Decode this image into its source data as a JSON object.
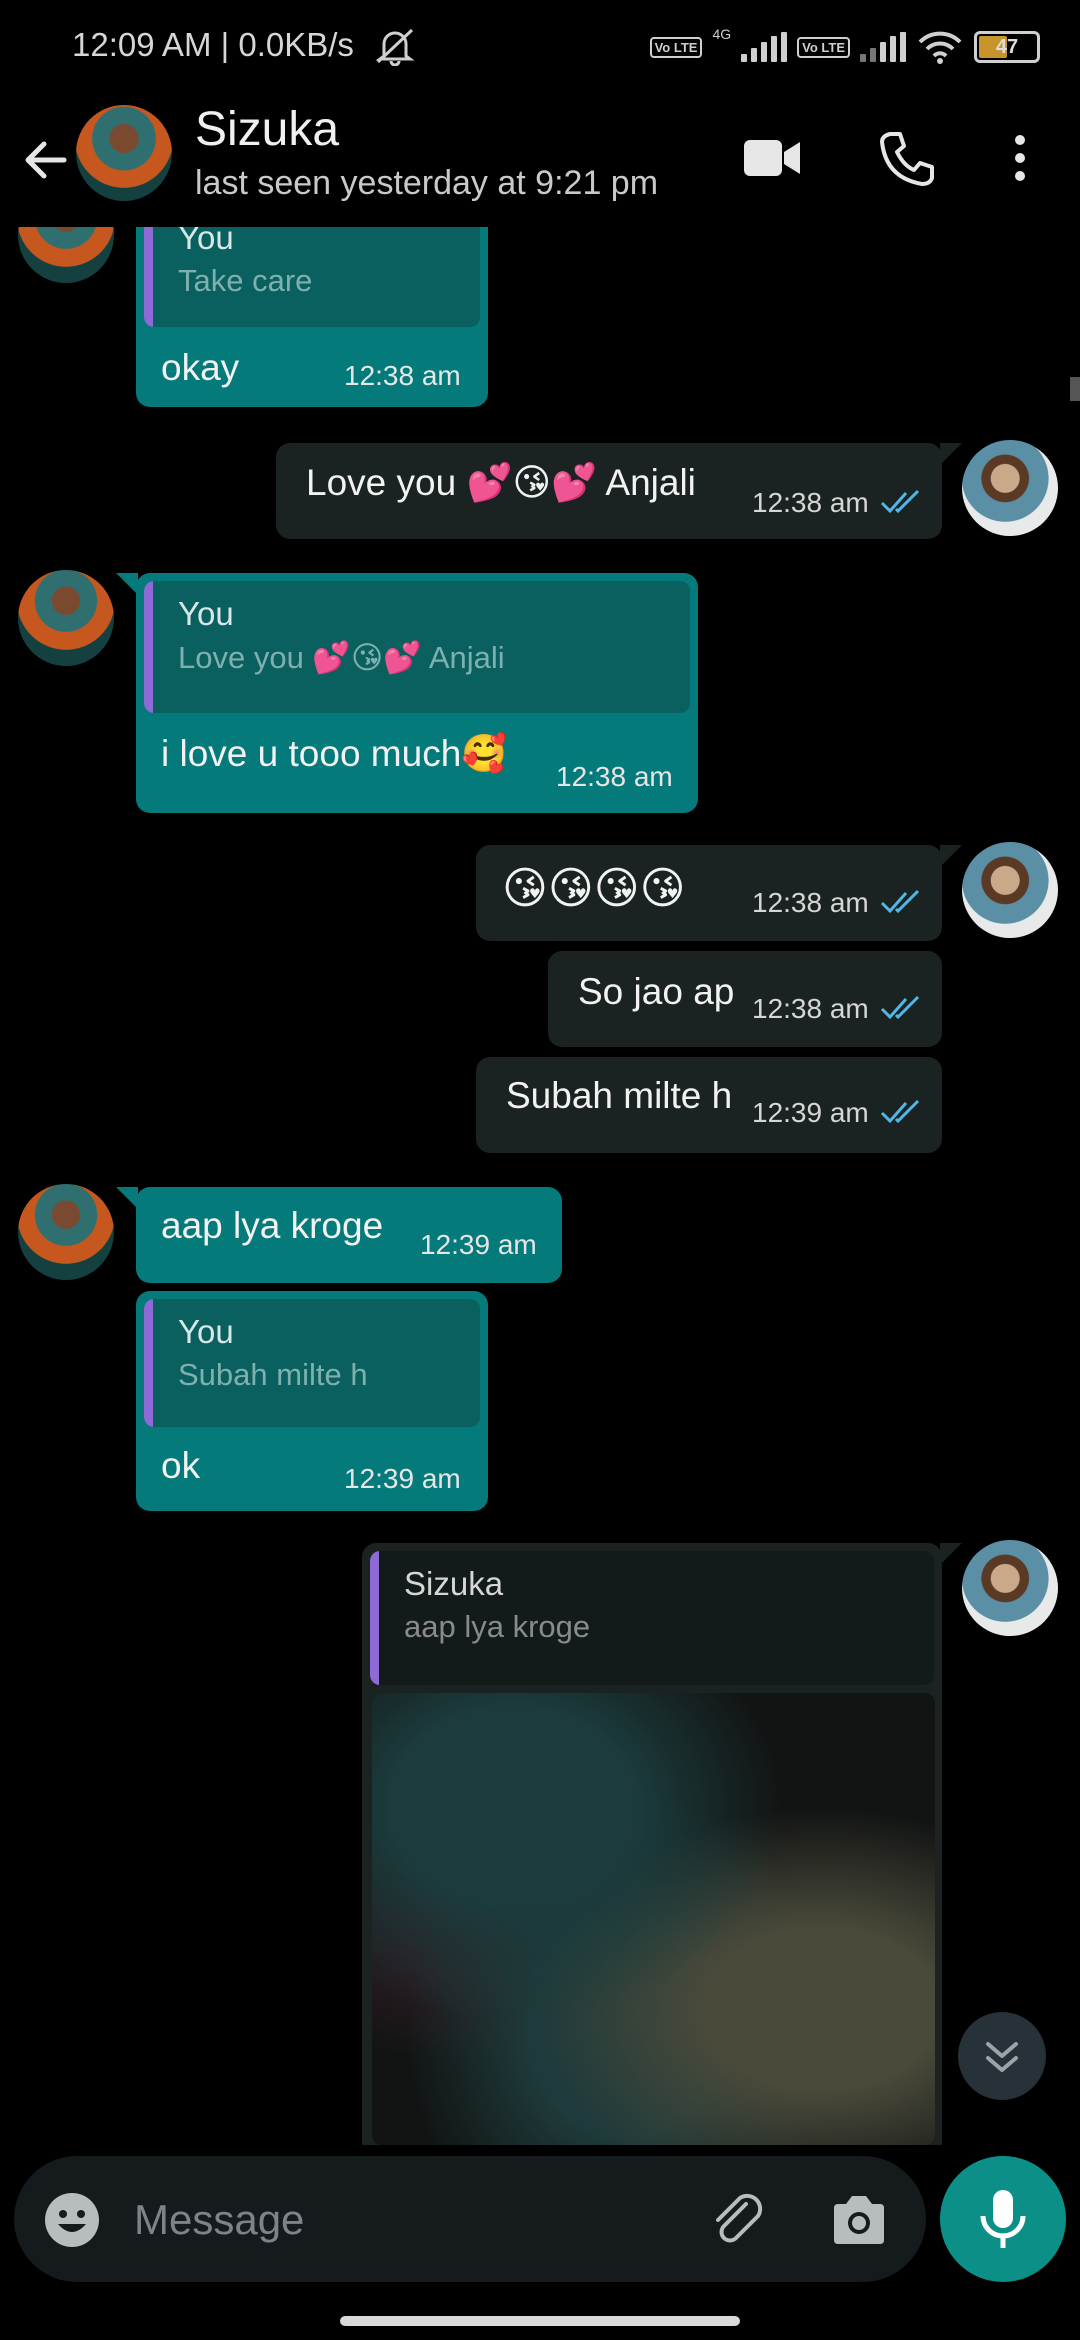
{
  "status_bar": {
    "text": "12:09 AM | 0.0KB/s",
    "volte_1": "Vo LTE",
    "network_type": "4G",
    "volte_2": "Vo LTE",
    "battery": "47"
  },
  "header": {
    "contact_name": "Sizuka",
    "last_seen": "last seen yesterday at 9:21 pm"
  },
  "messages": [
    {
      "direction": "in",
      "quote_author": "You",
      "quote_text": "Take care",
      "text": "okay",
      "time": "12:38 am"
    },
    {
      "direction": "out",
      "text": "Love you 💕😘💕 Anjali",
      "time": "12:38 am"
    },
    {
      "direction": "in",
      "quote_author": "You",
      "quote_text": "Love you 💕😘💕 Anjali",
      "text": "i love u tooo much🥰",
      "time": "12:38 am"
    },
    {
      "direction": "out",
      "text": "😘😘😘😘",
      "time": "12:38 am"
    },
    {
      "direction": "out",
      "text": "So jao ap",
      "time": "12:38 am"
    },
    {
      "direction": "out",
      "text": "Subah milte h",
      "time": "12:39 am"
    },
    {
      "direction": "in",
      "text": "aap lya kroge",
      "time": "12:39 am"
    },
    {
      "direction": "in",
      "quote_author": "You",
      "quote_text": "Subah milte h",
      "text": "ok",
      "time": "12:39 am"
    },
    {
      "direction": "out",
      "quote_author": "Sizuka",
      "quote_text": "aap lya kroge",
      "media": "image"
    }
  ],
  "compose": {
    "placeholder": "Message"
  },
  "colors": {
    "incoming_bubble": "#057a7b",
    "outgoing_bubble": "#1b2222",
    "read_ticks": "#4fb8e8",
    "mic_button": "#0b8f86",
    "quote_bar": "#8d6ad6"
  },
  "icons": [
    "back-arrow-icon",
    "video-call-icon",
    "phone-icon",
    "more-vertical-icon",
    "emoji-icon",
    "attachment-icon",
    "camera-icon",
    "mic-icon",
    "double-chevron-down-icon",
    "mute-bell-icon",
    "wifi-icon",
    "signal-icon",
    "battery-icon",
    "read-ticks-icon"
  ]
}
